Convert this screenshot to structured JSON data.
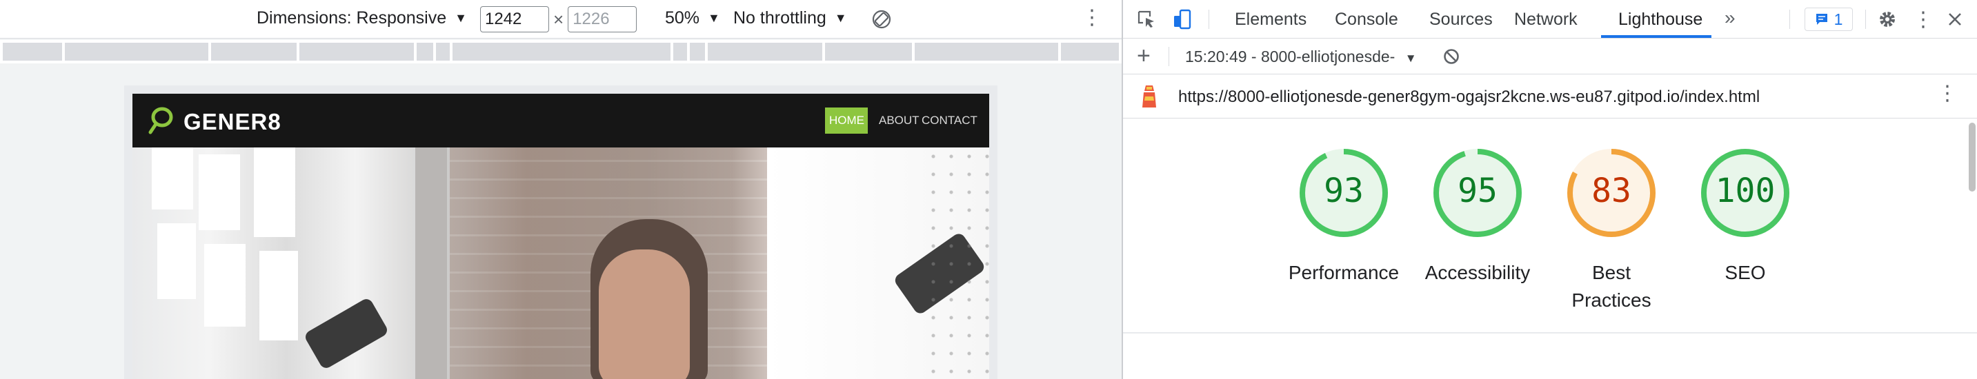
{
  "device_toolbar": {
    "dimensions_label": "Dimensions: Responsive",
    "width_value": "1242",
    "height_placeholder": "1226",
    "size_separator": "×",
    "zoom": "50%",
    "throttling": "No throttling"
  },
  "site": {
    "brand": "GENER8",
    "nav": [
      "HOME",
      "ABOUT",
      "CONTACT"
    ]
  },
  "devtools": {
    "tabs": [
      "Elements",
      "Console",
      "Sources",
      "Network",
      "Lighthouse"
    ],
    "active_tab": "Lighthouse",
    "more_tabs": "»",
    "issues_count": "1",
    "report_label": "15:20:49 - 8000-elliotjonesde-",
    "url": "https://8000-elliotjonesde-gener8gym-ogajsr2kcne.ws-eu87.gitpod.io/index.html",
    "scores": [
      {
        "value": "93",
        "label_line1": "Performance",
        "label_line2": ""
      },
      {
        "value": "95",
        "label_line1": "Accessibility",
        "label_line2": ""
      },
      {
        "value": "83",
        "label_line1": "Best",
        "label_line2": "Practices"
      },
      {
        "value": "100",
        "label_line1": "SEO",
        "label_line2": ""
      }
    ],
    "colors": {
      "pass": "#0c7c26",
      "pass_ring": "#49c763",
      "pass_fill": "#e8f6ea",
      "average": "#c33300",
      "average_ring": "#f2a33c",
      "average_fill": "#fdf3e6",
      "accent": "#1a73e8"
    }
  }
}
